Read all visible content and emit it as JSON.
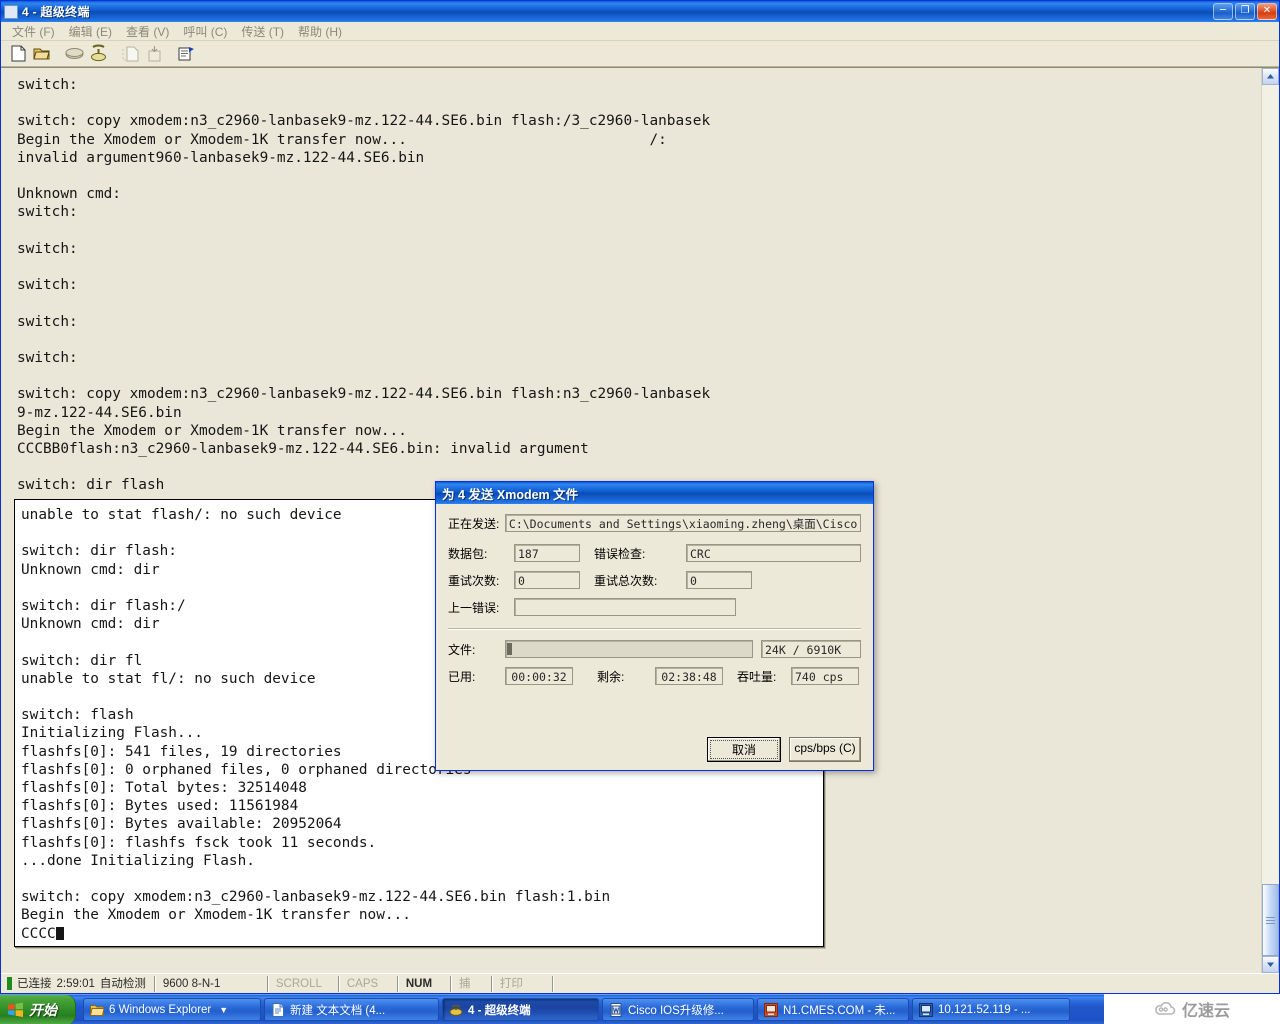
{
  "window": {
    "title": "4 - 超级终端",
    "minimize_label": "─",
    "maximize_label": "❐",
    "close_label": "✕"
  },
  "menubar": {
    "items": [
      {
        "label": "文件 (F)"
      },
      {
        "label": "编辑 (E)"
      },
      {
        "label": "查看 (V)"
      },
      {
        "label": "呼叫 (C)"
      },
      {
        "label": "传送 (T)"
      },
      {
        "label": "帮助 (H)"
      }
    ]
  },
  "toolbar": {
    "items": [
      {
        "name": "new-connection-icon"
      },
      {
        "name": "open-folder-icon"
      },
      {
        "name": "dial-icon"
      },
      {
        "name": "hangup-icon"
      },
      {
        "name": "send-file-icon"
      },
      {
        "name": "receive-file-icon"
      },
      {
        "name": "properties-icon"
      }
    ]
  },
  "terminal": {
    "top_text": "switch:\n\nswitch: copy xmodem:n3_c2960-lanbasek9-mz.122-44.SE6.bin flash:/3_c2960-lanbasek\nBegin the Xmodem or Xmodem-1K transfer now...                            /:\ninvalid argument960-lanbasek9-mz.122-44.SE6.bin\n\nUnknown cmd:\nswitch:\n\nswitch:\n\nswitch:\n\nswitch:\n\nswitch:\n\nswitch: copy xmodem:n3_c2960-lanbasek9-mz.122-44.SE6.bin flash:n3_c2960-lanbasek\n9-mz.122-44.SE6.bin\nBegin the Xmodem or Xmodem-1K transfer now...\nCCCBB0flash:n3_c2960-lanbasek9-mz.122-44.SE6.bin: invalid argument\n\nswitch: dir flash",
    "inner_text": "unable to stat flash/: no such device\n\nswitch: dir flash:\nUnknown cmd: dir\n\nswitch: dir flash:/\nUnknown cmd: dir\n\nswitch: dir fl\nunable to stat fl/: no such device\n\nswitch: flash\nInitializing Flash...\nflashfs[0]: 541 files, 19 directories\nflashfs[0]: 0 orphaned files, 0 orphaned directories\nflashfs[0]: Total bytes: 32514048\nflashfs[0]: Bytes used: 11561984\nflashfs[0]: Bytes available: 20952064\nflashfs[0]: flashfs fsck took 11 seconds.\n...done Initializing Flash.\n\nswitch: copy xmodem:n3_c2960-lanbasek9-mz.122-44.SE6.bin flash:1.bin\nBegin the Xmodem or Xmodem-1K transfer now...\nCCCC",
    "scrollbar": {
      "up_arrow": "▲",
      "down_arrow": "▼"
    }
  },
  "statusbar": {
    "connected_label": "已连接",
    "elapsed": "2:59:01",
    "detect": "自动检测",
    "line_settings": "9600 8-N-1",
    "scroll": "SCROLL",
    "caps": "CAPS",
    "num": "NUM",
    "capture": "捕",
    "print": "打印"
  },
  "dialog": {
    "title": "为 4 发送 Xmodem 文件",
    "sending_label": "正在发送:",
    "sending_value": "C:\\Documents and Settings\\xiaoming.zheng\\桌面\\Cisco Backup_",
    "packet_label": "数据包:",
    "packet_value": "187",
    "errorcheck_label": "错误检查:",
    "errorcheck_value": "CRC",
    "retries_label": "重试次数:",
    "retries_value": "0",
    "total_retries_label": "重试总次数:",
    "total_retries_value": "0",
    "last_error_label": "上一错误:",
    "last_error_value": "",
    "file_label": "文件:",
    "file_progress_value": "24K / 6910K",
    "file_progress_percent": 0.35,
    "elapsed_label": "已用:",
    "elapsed_value": "00:00:32",
    "remaining_label": "剩余:",
    "remaining_value": "02:38:48",
    "throughput_label": "吞吐量:",
    "throughput_value": "740 cps",
    "cancel_button": "取消",
    "cpsbps_button": "cps/bps (C)"
  },
  "taskbar": {
    "start_label": "开始",
    "tasks": [
      {
        "label": "6 Windows Explorer",
        "icon": "folder-icon",
        "active": false,
        "has_caret": true
      },
      {
        "label": "新建 文本文档 (4...",
        "icon": "notepad-icon",
        "active": false,
        "has_caret": false
      },
      {
        "label": "4 - 超级终端",
        "icon": "hyperterminal-icon",
        "active": true,
        "has_caret": false
      },
      {
        "label": "Cisco IOS升级修...",
        "icon": "word-icon",
        "active": false,
        "has_caret": false
      },
      {
        "label": "N1.CMES.COM - 未...",
        "icon": "rdp-icon",
        "active": false,
        "has_caret": false
      },
      {
        "label": "10.121.52.119 - ...",
        "icon": "rdp-icon",
        "active": false,
        "has_caret": false
      }
    ],
    "tray": [
      {
        "name": "keyboard-icon"
      },
      {
        "name": "help-icon"
      },
      {
        "name": "network-icon"
      },
      {
        "name": "show-hidden-icons-icon"
      }
    ]
  },
  "watermark": {
    "text": "亿速云"
  },
  "colors": {
    "terminal_bg": "#eae7d9",
    "window_chrome": "#ece9d8",
    "titlebar_blue": "#0b55c8",
    "taskbar_blue": "#2157cd",
    "start_green": "#2e8b26"
  }
}
